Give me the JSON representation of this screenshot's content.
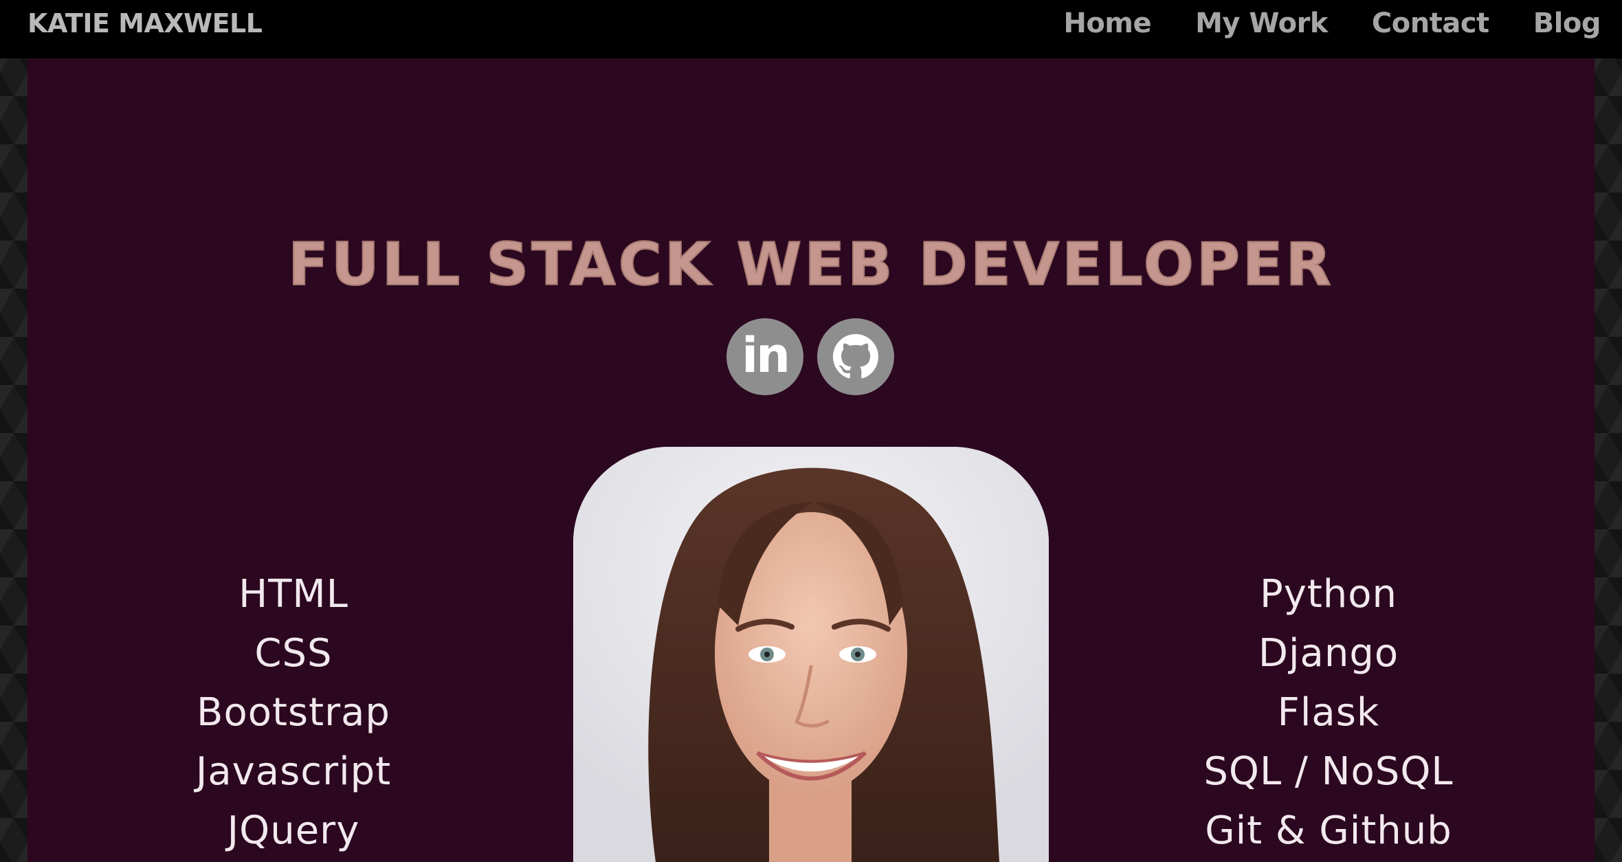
{
  "header": {
    "brand": "KATIE MAXWELL",
    "nav": [
      {
        "label": "Home"
      },
      {
        "label": "My Work"
      },
      {
        "label": "Contact"
      },
      {
        "label": "Blog"
      }
    ]
  },
  "hero": {
    "headline": "FULL STACK WEB DEVELOPER",
    "socials": [
      {
        "icon": "linkedin-icon",
        "glyph": "in"
      },
      {
        "icon": "github-icon"
      }
    ],
    "portrait": {
      "icon": "profile-photo"
    }
  },
  "skills": {
    "left": [
      "HTML",
      "CSS",
      "Bootstrap",
      "Javascript",
      "JQuery"
    ],
    "right": [
      "Python",
      "Django",
      "Flask",
      "SQL / NoSQL",
      "Git & Github"
    ]
  },
  "colors": {
    "navbar": "#000000",
    "panel": "#2c0720",
    "headline": "#c5968d",
    "nav_text": "#a6a6a6",
    "social_bg": "#8e8e8e",
    "skill_text": "#f2e9ee"
  }
}
